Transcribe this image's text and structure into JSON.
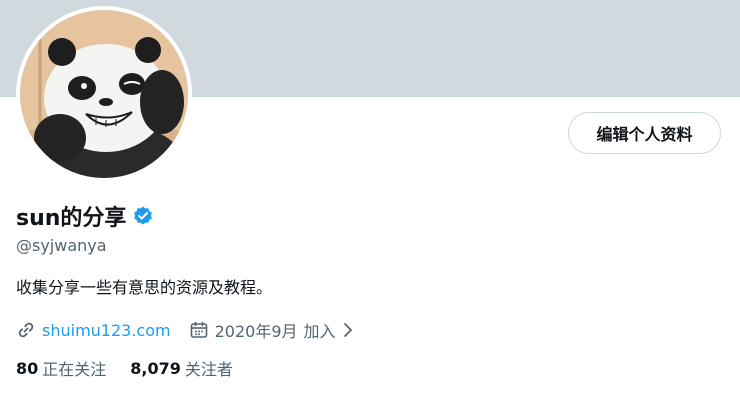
{
  "profile": {
    "display_name": "sun的分享",
    "handle": "@syjwanya",
    "bio": "收集分享一些有意思的资源及教程。",
    "verified_icon": "verified-badge-icon",
    "avatar_icon": "panda-avatar"
  },
  "actions": {
    "edit_profile_label": "编辑个人资料"
  },
  "meta": {
    "link_icon": "link-icon",
    "website": "shuimu123.com",
    "calendar_icon": "calendar-icon",
    "joined_date": "2020年9月",
    "joined_label": "加入",
    "expand_icon": "chevron-right-icon"
  },
  "stats": {
    "following_count": "80",
    "following_label": "正在关注",
    "followers_count": "8,079",
    "followers_label": "关注者"
  },
  "colors": {
    "banner": "#cfd9de",
    "accent": "#1d9bf0",
    "secondary_text": "#536471",
    "primary_text": "#0f1419"
  }
}
